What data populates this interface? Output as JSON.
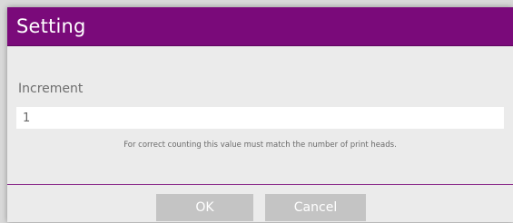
{
  "dialog": {
    "title": "Setting",
    "accent_color": "#7a0a7a"
  },
  "increment": {
    "label": "Increment",
    "value": "1",
    "hint": "For correct counting this value must match the number of print heads."
  },
  "buttons": {
    "ok_label": "OK",
    "cancel_label": "Cancel"
  }
}
